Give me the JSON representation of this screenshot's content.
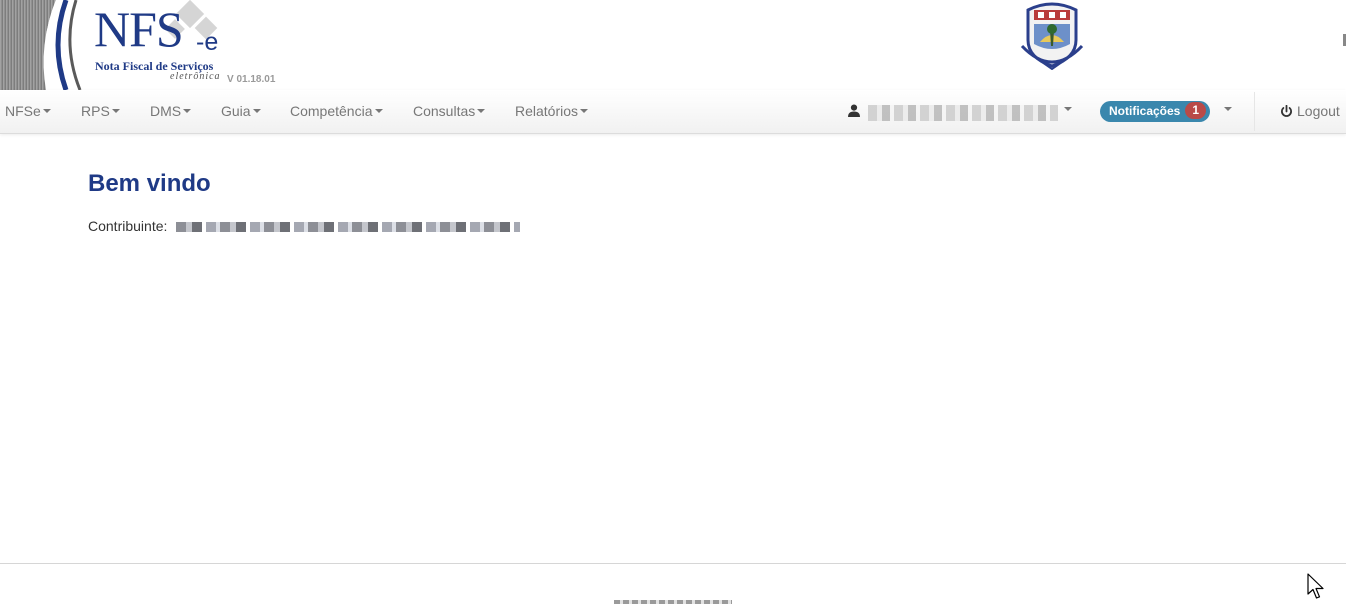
{
  "header": {
    "logo_main": "NFS",
    "logo_suffix": "-e",
    "logo_subtitle": "Nota Fiscal de Serviços",
    "logo_tagline": "eletrônica",
    "version": "V 01.18.01",
    "crest_icon": "municipal-crest-icon"
  },
  "navbar": {
    "menus": [
      {
        "label": "NFSe"
      },
      {
        "label": "RPS"
      },
      {
        "label": "DMS"
      },
      {
        "label": "Guia"
      },
      {
        "label": "Competência"
      },
      {
        "label": "Consultas"
      },
      {
        "label": "Relatórios"
      }
    ],
    "user_icon": "user-icon",
    "notifications": {
      "label": "Notificações",
      "count": "1"
    },
    "logout": {
      "label": "Logout",
      "icon": "power-icon"
    }
  },
  "main": {
    "title": "Bem vindo",
    "contributor_label": "Contribuinte:"
  },
  "colors": {
    "brand_blue": "#1f3a86",
    "notification_pill": "#3a87ad",
    "notification_badge": "#b94a48",
    "nav_text": "#777777"
  }
}
